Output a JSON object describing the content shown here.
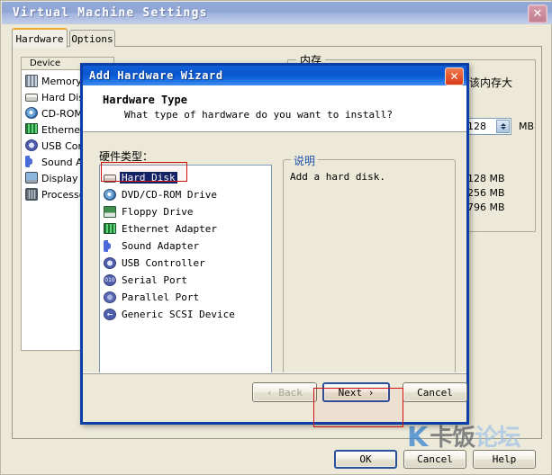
{
  "outer_window": {
    "title": "Virtual Machine Settings",
    "close_label": "✕",
    "tabs": [
      {
        "label": "Hardware",
        "active": true
      },
      {
        "label": "Options",
        "active": false
      }
    ],
    "device_panel": {
      "header": "Device",
      "rows": [
        {
          "label": "Memory",
          "icon": "memory-icon"
        },
        {
          "label": "Hard Disk",
          "icon": "hard-disk-icon"
        },
        {
          "label": "CD-ROM",
          "icon": "cd-rom-icon"
        },
        {
          "label": "Ethernet",
          "icon": "ethernet-icon"
        },
        {
          "label": "USB Con",
          "icon": "usb-controller-icon"
        },
        {
          "label": "Sound Ad",
          "icon": "sound-adapter-icon"
        },
        {
          "label": "Display",
          "icon": "display-icon"
        },
        {
          "label": "Processo",
          "icon": "processor-icon"
        }
      ]
    },
    "memory_panel": {
      "legend": "内存",
      "note": "该内存大",
      "value": "128",
      "unit": "MB",
      "marks": [
        "128 MB",
        "256 MB",
        "796 MB"
      ],
      "paren": ")"
    },
    "buttons": {
      "ok": "OK",
      "cancel": "Cancel",
      "help": "Help"
    }
  },
  "watermark": {
    "k": "K",
    "cn_dark": "卡饭",
    "cn_light": "论坛"
  },
  "wizard": {
    "title": "Add Hardware Wizard",
    "close_label": "✕",
    "heading": "Hardware Type",
    "subheading": "What type of hardware do you want to install?",
    "list_label": "硬件类型：",
    "items": [
      {
        "label": "Hard Disk",
        "icon": "hard-disk-icon",
        "selected": true
      },
      {
        "label": "DVD/CD-ROM Drive",
        "icon": "cd-rom-icon",
        "selected": false
      },
      {
        "label": "Floppy Drive",
        "icon": "floppy-icon",
        "selected": false
      },
      {
        "label": "Ethernet Adapter",
        "icon": "ethernet-icon",
        "selected": false
      },
      {
        "label": "Sound Adapter",
        "icon": "sound-adapter-icon",
        "selected": false
      },
      {
        "label": "USB Controller",
        "icon": "usb-controller-icon",
        "selected": false
      },
      {
        "label": "Serial Port",
        "icon": "serial-port-icon",
        "selected": false
      },
      {
        "label": "Parallel Port",
        "icon": "parallel-port-icon",
        "selected": false
      },
      {
        "label": "Generic SCSI Device",
        "icon": "scsi-icon",
        "selected": false
      }
    ],
    "description": {
      "legend": "说明",
      "text": "Add a hard disk."
    },
    "buttons": {
      "back": "‹ Back",
      "next": "Next ›",
      "cancel": "Cancel"
    }
  },
  "annotations": {
    "accent_color": "#d01010",
    "selection_color": "#0a246a"
  }
}
